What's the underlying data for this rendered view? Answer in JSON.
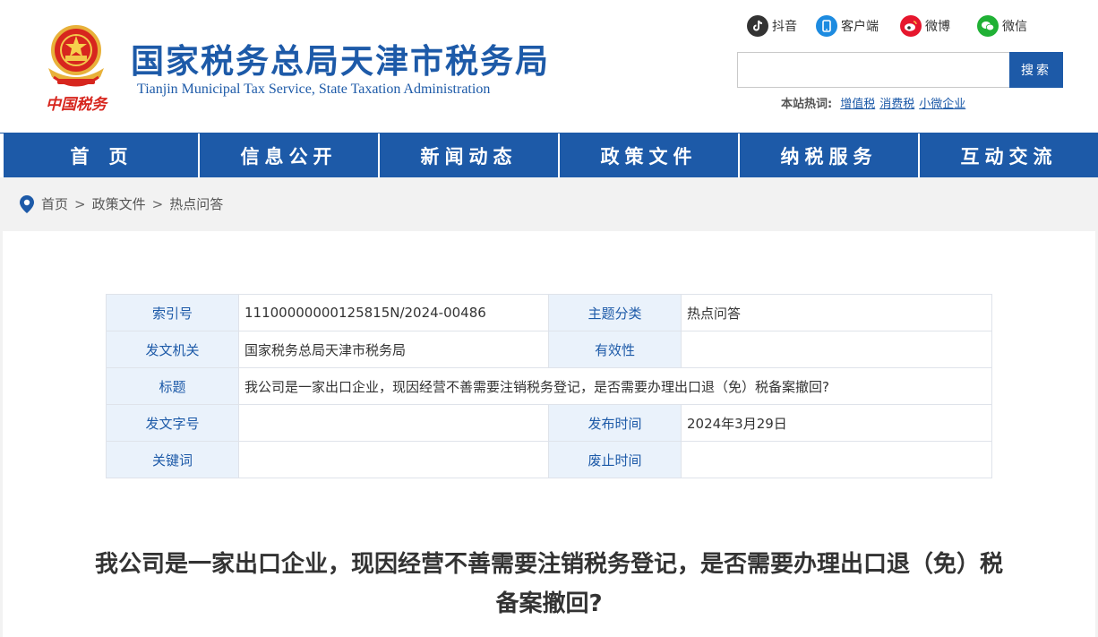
{
  "header": {
    "title": "国家税务总局天津市税务局",
    "subtitle": "Tianjin Municipal Tax Service, State Taxation Administration",
    "emblem_text": "中国税务"
  },
  "social": [
    {
      "label": "抖音",
      "icon": "douyin-icon",
      "color": "#333333"
    },
    {
      "label": "客户端",
      "icon": "mobile-client-icon",
      "color": "#1d8be0"
    },
    {
      "label": "微博",
      "icon": "weibo-icon",
      "color": "#e6162d"
    },
    {
      "label": "微信",
      "icon": "wechat-icon",
      "color": "#20b135"
    }
  ],
  "search": {
    "placeholder": "",
    "button": "搜索"
  },
  "hot": {
    "label": "本站热词:",
    "words": [
      "增值税",
      "消费税",
      "小微企业"
    ]
  },
  "nav": [
    "首页",
    "信息公开",
    "新闻动态",
    "政策文件",
    "纳税服务",
    "互动交流"
  ],
  "breadcrumb": {
    "icon": "location-pin-icon",
    "items": [
      "首页",
      "政策文件",
      "热点问答"
    ],
    "separator": ">"
  },
  "meta": {
    "index_label": "索引号",
    "index_value": "11100000000125815N/2024-00486",
    "topic_label": "主题分类",
    "topic_value": "热点问答",
    "issuer_label": "发文机关",
    "issuer_value": "国家税务总局天津市税务局",
    "validity_label": "有效性",
    "validity_value": "",
    "title_label": "标题",
    "title_value": "我公司是一家出口企业，现因经营不善需要注销税务登记，是否需要办理出口退（免）税备案撤回?",
    "docno_label": "发文字号",
    "docno_value": "",
    "pubdate_label": "发布时间",
    "pubdate_value": "2024年3月29日",
    "keywords_label": "关键词",
    "keywords_value": "",
    "expiry_label": "废止时间",
    "expiry_value": ""
  },
  "article": {
    "title": "我公司是一家出口企业，现因经营不善需要注销税务登记，是否需要办理出口退（免）税备案撤回?"
  },
  "colors": {
    "brand_blue": "#1d5aa8",
    "emblem_red": "#d7261e",
    "key_cell_bg": "#eaf2fb"
  }
}
